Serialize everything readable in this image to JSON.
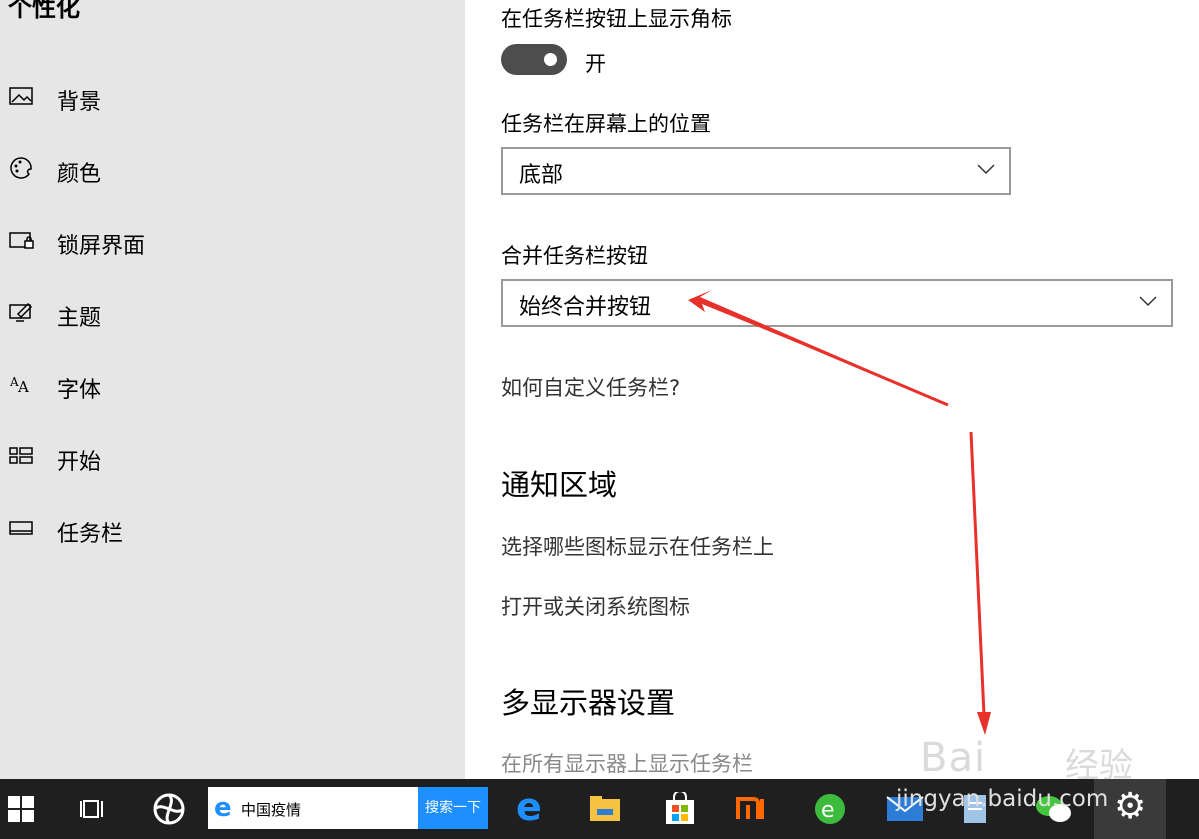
{
  "sidebar": {
    "title": "个性化",
    "items": [
      {
        "label": "背景",
        "icon": "image-icon"
      },
      {
        "label": "颜色",
        "icon": "palette-icon"
      },
      {
        "label": "锁屏界面",
        "icon": "lock-screen-icon"
      },
      {
        "label": "主题",
        "icon": "theme-icon"
      },
      {
        "label": "字体",
        "icon": "font-icon"
      },
      {
        "label": "开始",
        "icon": "start-icon"
      },
      {
        "label": "任务栏",
        "icon": "taskbar-icon"
      }
    ]
  },
  "main": {
    "badge_heading": "在任务栏按钮上显示角标",
    "badge_toggle_state": "开",
    "position_heading": "任务栏在屏幕上的位置",
    "position_value": "底部",
    "combine_heading": "合并任务栏按钮",
    "combine_value": "始终合并按钮",
    "help_link": "如何自定义任务栏?",
    "notification_heading": "通知区域",
    "notification_link1": "选择哪些图标显示在任务栏上",
    "notification_link2": "打开或关闭系统图标",
    "multi_display_heading": "多显示器设置",
    "multi_display_option": "在所有显示器上显示任务栏"
  },
  "taskbar": {
    "search_text": "中国疫情",
    "search_button": "搜索一下",
    "colors": {
      "bg": "#1f1f1f",
      "search_btn": "#1e8fff"
    }
  },
  "watermark": {
    "text1": "Bai",
    "text2": "经验",
    "text3": "jingyan.baidu.com"
  }
}
